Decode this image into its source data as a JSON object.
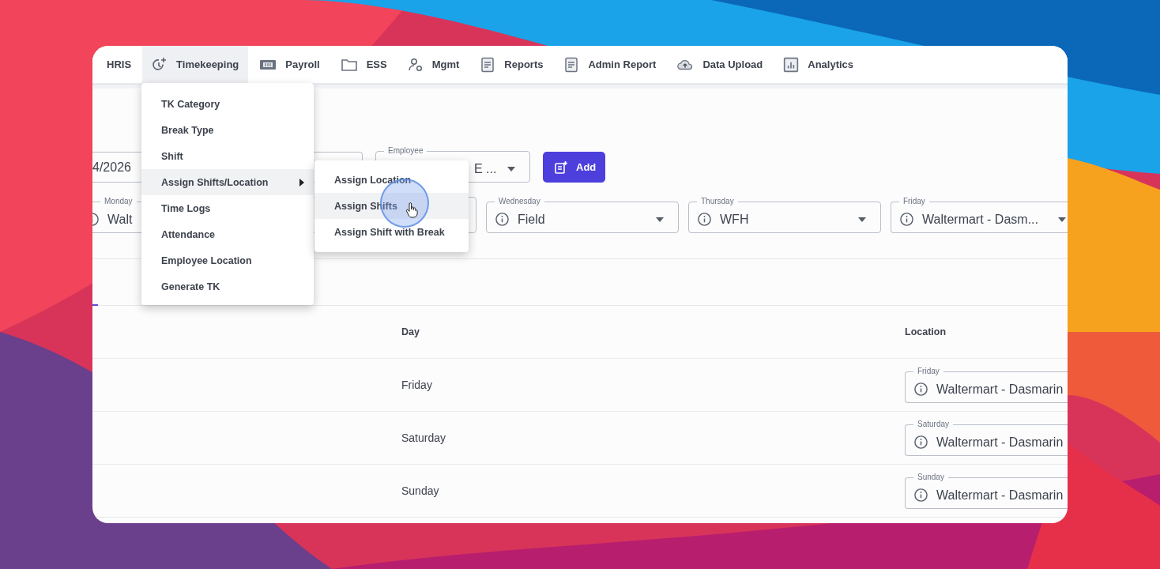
{
  "nav": [
    {
      "label": "HRIS",
      "selected": false
    },
    {
      "label": "Timekeeping",
      "selected": true
    },
    {
      "label": "Payroll",
      "selected": false
    },
    {
      "label": "ESS",
      "selected": false
    },
    {
      "label": "Mgmt",
      "selected": false
    },
    {
      "label": "Reports",
      "selected": false
    },
    {
      "label": "Admin Report",
      "selected": false
    },
    {
      "label": "Data Upload",
      "selected": false
    },
    {
      "label": "Analytics",
      "selected": false
    }
  ],
  "menu": [
    {
      "label": "TK Category",
      "selected": false,
      "has_submenu": false
    },
    {
      "label": "Break Type",
      "selected": false,
      "has_submenu": false
    },
    {
      "label": "Shift",
      "selected": false,
      "has_submenu": false
    },
    {
      "label": "Assign Shifts/Location",
      "selected": true,
      "has_submenu": true
    },
    {
      "label": "Time Logs",
      "selected": false,
      "has_submenu": false
    },
    {
      "label": "Attendance",
      "selected": false,
      "has_submenu": false
    },
    {
      "label": "Employee Location",
      "selected": false,
      "has_submenu": false
    },
    {
      "label": "Generate TK",
      "selected": false,
      "has_submenu": false
    }
  ],
  "submenu": [
    {
      "label": "Assign Location",
      "selected": false
    },
    {
      "label": "Assign Shifts",
      "selected": true
    },
    {
      "label": "Assign Shift with Break",
      "selected": false
    }
  ],
  "filters": {
    "date": {
      "value": "4/2026"
    },
    "employee": {
      "label": "Employee",
      "value": "E ..."
    },
    "add_button": "Add"
  },
  "day_fields": [
    {
      "label": "Monday",
      "value": "Walt"
    },
    {
      "label": "Wednesday",
      "value": "Field"
    },
    {
      "label": "Thursday",
      "value": "WFH"
    },
    {
      "label": "Friday",
      "value": "Waltermart - Dasm..."
    }
  ],
  "table": {
    "columns": [
      "Day",
      "Location"
    ],
    "rows": [
      {
        "day": "Friday",
        "location_label": "Friday",
        "location": "Waltermart - Dasmarin"
      },
      {
        "day": "Saturday",
        "location_label": "Saturday",
        "location": "Waltermart - Dasmarin"
      },
      {
        "day": "Sunday",
        "location_label": "Sunday",
        "location": "Waltermart - Dasmarin"
      }
    ]
  }
}
